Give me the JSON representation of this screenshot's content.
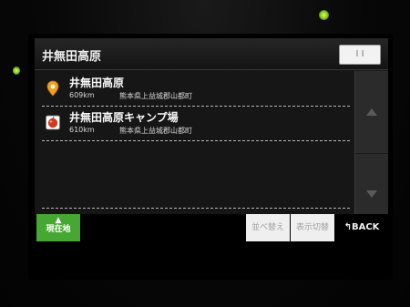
{
  "header": {
    "title": "井無田高原",
    "button_label": "I I"
  },
  "results": [
    {
      "name": "井無田高原",
      "distance": "609km",
      "address": "熊本県上益城郡山都町",
      "icon": "map-pin-icon"
    },
    {
      "name": "井無田高原キャンプ場",
      "distance": "610km",
      "address": "熊本県上益城郡山都町",
      "icon": "campground-icon"
    },
    {
      "name": "",
      "distance": "",
      "address": "",
      "icon": ""
    },
    {
      "name": "",
      "distance": "",
      "address": "",
      "icon": ""
    }
  ],
  "footer": {
    "location_label": "現在地",
    "sort_label": "並べ替え",
    "display_label": "表示切替",
    "back_label": "BACK"
  },
  "colors": {
    "location_button": "#46a832",
    "pin": "#f0a020",
    "campground": "#d23a1e",
    "led": "#a6e22e"
  }
}
